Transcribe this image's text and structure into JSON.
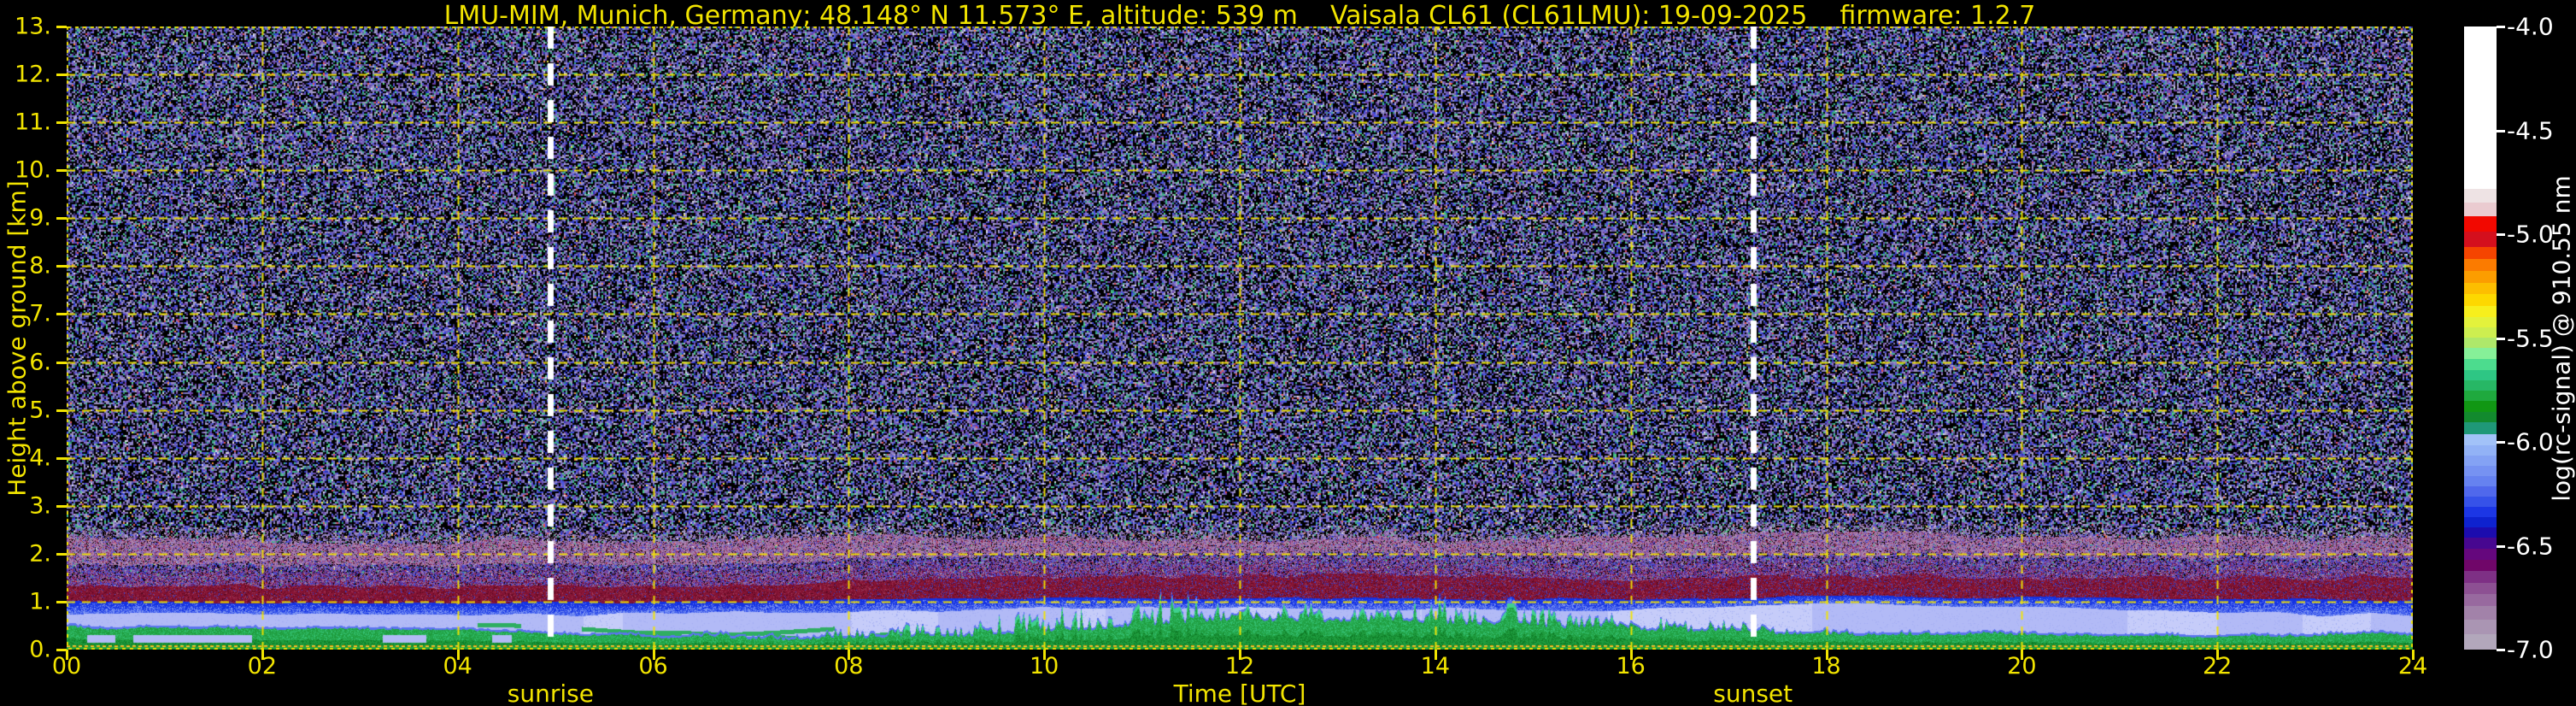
{
  "figure": {
    "background": "#000000",
    "axis_text_color": "#f2e400",
    "colorbar_text_color": "#ffffff"
  },
  "chart_data": {
    "type": "heatmap",
    "title": "LMU-MIM, Munich, Germany; 48.148° N 11.573° E, altitude: 539 m    Vaisala CL61 (CL61LMU): 19-09-2025    firmware: 1.2.7",
    "xlabel": "Time [UTC]",
    "ylabel": "Height above ground [km]",
    "colorbar_label": "log(rc-signal) @ 910.55 nm",
    "x_range_hours": [
      0,
      24
    ],
    "y_range_km": [
      0,
      13
    ],
    "value_range": [
      -4.0,
      -7.0
    ],
    "x_ticks": [
      "00",
      "02",
      "04",
      "06",
      "08",
      "10",
      "12",
      "14",
      "16",
      "18",
      "20",
      "22",
      "24"
    ],
    "y_ticks": [
      "0.",
      "1.",
      "2.",
      "3.",
      "4.",
      "5.",
      "6.",
      "7.",
      "8.",
      "9.",
      "10.",
      "11.",
      "12.",
      "13."
    ],
    "colorbar_ticks": [
      "-4.0",
      "-4.5",
      "-5.0",
      "-5.5",
      "-6.0",
      "-6.5",
      "-7.0"
    ],
    "grid": {
      "show": true,
      "color": "#f2e400",
      "style": "dashed",
      "x_step_hours": 2,
      "y_step_km": 1
    },
    "annotations": {
      "sunrise": {
        "label": "sunrise",
        "time_utc_hours": 4.95,
        "line_color": "#ffffff",
        "line_style": "dashed"
      },
      "sunset": {
        "label": "sunset",
        "time_utc_hours": 17.25,
        "line_color": "#ffffff",
        "line_style": "dashed"
      }
    },
    "colorbar_colors": [
      "#ffffff",
      "#eee3e4",
      "#eacbd0",
      "#f20800",
      "#d40f1d",
      "#f54400",
      "#fb7b00",
      "#fc9d00",
      "#fdbe00",
      "#fdd800",
      "#f7ef1c",
      "#e3f23c",
      "#cdee50",
      "#aee86a",
      "#86f098",
      "#4cdc8e",
      "#2ec684",
      "#27b765",
      "#1fa93e",
      "#119714",
      "#128a2e",
      "#1f9878",
      "#a2c2f8",
      "#92b2f6",
      "#84a2f4",
      "#7692f2",
      "#6682f0",
      "#5068ec",
      "#3652e9",
      "#1c36e5",
      "#0e22cf",
      "#1c0cae",
      "#470790",
      "#65077d",
      "#700669",
      "#7e3085",
      "#8d5093",
      "#98699f",
      "#a282a9",
      "#aa95b3",
      "#b2a7bb"
    ],
    "colorbar_weights": [
      0.317,
      0.026,
      0.027,
      0.03,
      0.03,
      0.023,
      0.023,
      0.024,
      0.022,
      0.022,
      0.022,
      0.02,
      0.02,
      0.02,
      0.022,
      0.022,
      0.02,
      0.02,
      0.02,
      0.022,
      0.02,
      0.022,
      0.022,
      0.02,
      0.02,
      0.02,
      0.02,
      0.02,
      0.02,
      0.02,
      0.02,
      0.02,
      0.022,
      0.022,
      0.022,
      0.022,
      0.022,
      0.024,
      0.026,
      0.028,
      0.03
    ],
    "noise_palette": {
      "colors": [
        "#000000",
        "#8478c6",
        "#9a90c2",
        "#6a5cb4",
        "#4a55e2",
        "#2a35c2",
        "#6e40a6",
        "#40b48e",
        "#2a9a70",
        "#303066",
        "#b0a8cc",
        "#d8d8ea",
        "#52d082",
        "#e8e44e",
        "#f08c3a",
        "#e05052"
      ],
      "weights": [
        0.4,
        0.09,
        0.08,
        0.07,
        0.07,
        0.04,
        0.06,
        0.05,
        0.02,
        0.05,
        0.03,
        0.01,
        0.012,
        0.004,
        0.004,
        0.008
      ]
    },
    "profiles": {
      "hours": [
        0,
        2,
        4,
        6,
        8,
        10,
        12,
        14,
        16,
        18,
        20,
        22,
        24
      ],
      "aerosol_green_top_km": [
        0.44,
        0.4,
        0.36,
        0.25,
        0.2,
        0.34,
        0.62,
        0.55,
        0.42,
        0.3,
        0.28,
        0.27,
        0.3
      ],
      "spike_amplitude_km": [
        0.05,
        0.04,
        0.04,
        0.05,
        0.18,
        0.45,
        0.5,
        0.45,
        0.3,
        0.1,
        0.06,
        0.05,
        0.05
      ],
      "pale_layer_top_km": [
        0.76,
        0.72,
        0.7,
        0.74,
        0.8,
        0.84,
        0.86,
        0.84,
        0.8,
        0.96,
        0.9,
        0.76,
        0.7
      ],
      "blue_band_top_km": [
        1.0,
        0.97,
        0.96,
        0.98,
        1.02,
        1.05,
        1.06,
        1.05,
        1.04,
        1.1,
        1.08,
        1.04,
        1.02
      ],
      "red_band_top_km": [
        1.35,
        1.3,
        1.28,
        1.32,
        1.42,
        1.5,
        1.54,
        1.52,
        1.45,
        1.52,
        1.5,
        1.48,
        1.5
      ],
      "haze_top_km": [
        2.35,
        2.28,
        2.24,
        2.28,
        2.34,
        2.36,
        2.3,
        2.28,
        2.32,
        2.42,
        2.38,
        2.3,
        2.28
      ]
    },
    "layer_colors": {
      "green": [
        "#1f9c3e",
        "#27ae54",
        "#168a30",
        "#36c275"
      ],
      "green_bright": "#3fd08e",
      "green_dark": "#0e7d26",
      "streak_green": "#2fae62",
      "edge_blue": "#5b74ee",
      "pale": [
        "#b2baf6",
        "#c6ccf9",
        "#a4aef2"
      ],
      "blue_low": "#7b93f3",
      "blue_mid": "#3a58ec",
      "blue_high": "#1432e2",
      "maroon": [
        "#7c1030",
        "#8c1838",
        "#55081f",
        "#a04060"
      ],
      "transition_blue": "#3346d8",
      "transition_purple": "#5a2a9a",
      "haze_pink": [
        "#b088ae",
        "#9e6b9c",
        "#8d4090"
      ],
      "ground_line_orange": "#f59a00",
      "ground_line_gold": "#ffd24a",
      "ground_green": "#27a73e"
    }
  }
}
